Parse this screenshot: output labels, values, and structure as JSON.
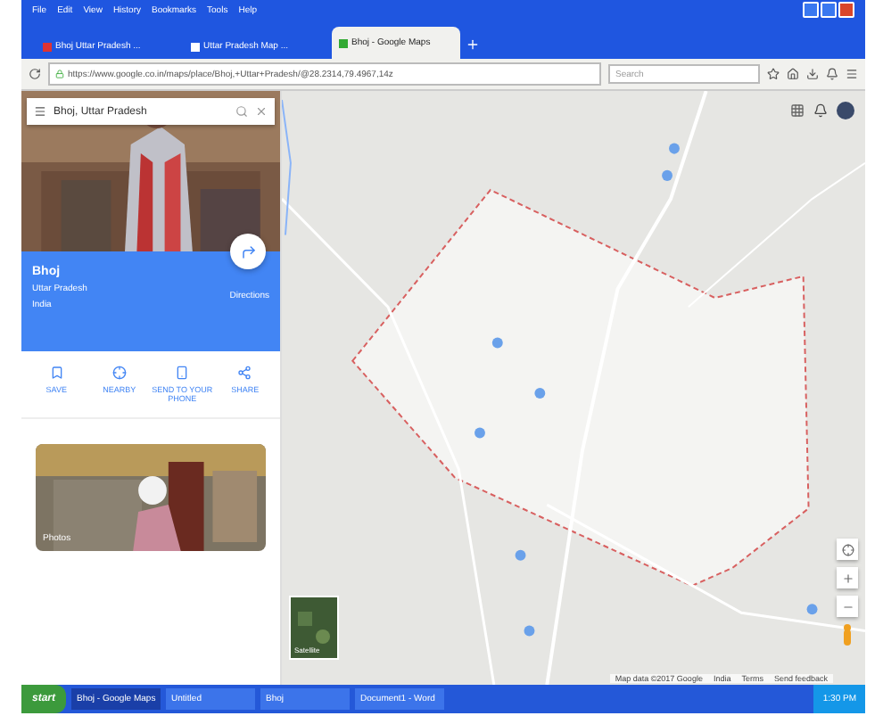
{
  "browser": {
    "menu": [
      "File",
      "Edit",
      "View",
      "History",
      "Bookmarks",
      "Tools",
      "Help"
    ],
    "tabs": [
      {
        "label": "Bhoj Uttar Pradesh ...",
        "selected": false
      },
      {
        "label": "Uttar Pradesh Map ...",
        "selected": false
      },
      {
        "label": "Bhoj - Google Maps",
        "selected": true
      }
    ],
    "url": "https://www.google.co.in/maps/place/Bhoj,+Uttar+Pradesh/@28.2314,79.4967,14z",
    "search_placeholder": "Search"
  },
  "place": {
    "search": "Bhoj, Uttar Pradesh",
    "name": "Bhoj",
    "lines": [
      "Uttar Pradesh",
      "India"
    ],
    "directions": "Directions",
    "actions": [
      {
        "kind": "save",
        "label": "SAVE"
      },
      {
        "kind": "nearby",
        "label": "NEARBY"
      },
      {
        "kind": "phone",
        "label": "SEND TO YOUR PHONE"
      },
      {
        "kind": "share",
        "label": "SHARE"
      }
    ],
    "photo_caption": "Photos"
  },
  "map": {
    "satellite": "Satellite",
    "footer": [
      "Map data ©2017 Google",
      "India",
      "Terms",
      "Send feedback"
    ]
  },
  "taskbar": {
    "start": "start",
    "items": [
      {
        "label": "Bhoj - Google Maps",
        "selected": true
      },
      {
        "label": "Untitled",
        "selected": false
      },
      {
        "label": "Bhoj",
        "selected": false
      },
      {
        "label": "Document1 - Word",
        "selected": false
      }
    ],
    "clock": "1:30 PM"
  }
}
